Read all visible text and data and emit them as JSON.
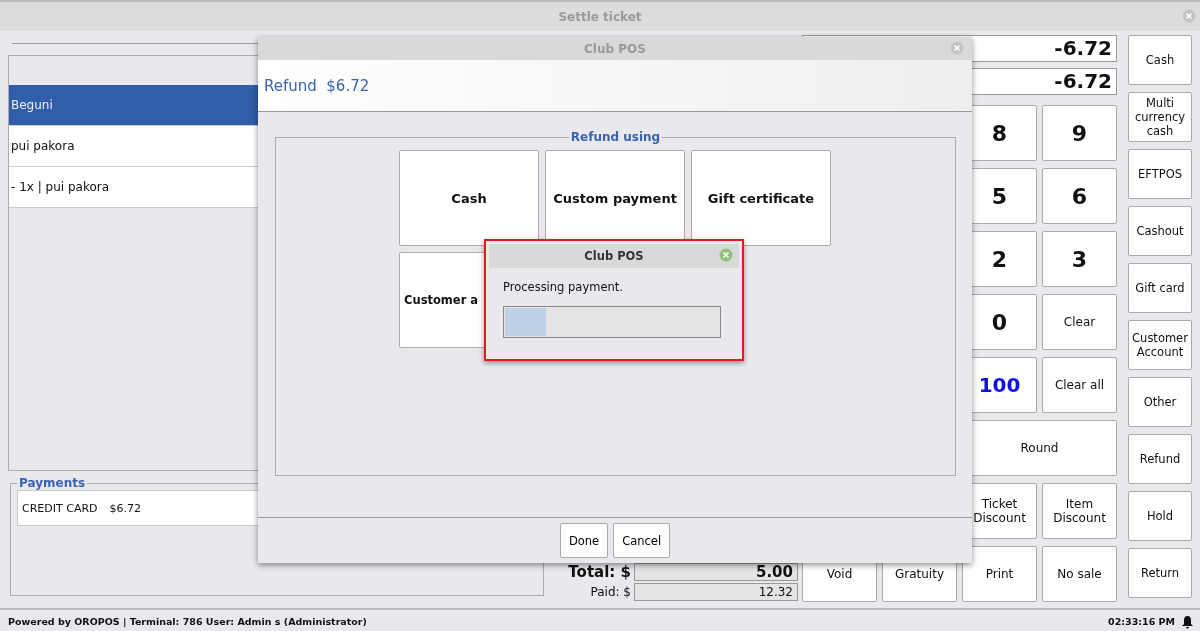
{
  "window": {
    "title": "Settle ticket"
  },
  "ticket_items": [
    {
      "label": "Beguni",
      "selected": true
    },
    {
      "label": "pui pakora",
      "selected": false
    },
    {
      "label": "- 1x | pui pakora",
      "selected": false
    }
  ],
  "payments": {
    "legend": "Payments",
    "rows": [
      {
        "type": "CREDIT CARD",
        "amount": "$6.72"
      }
    ]
  },
  "totals": [
    {
      "label": "Total: $",
      "value": "5.00"
    },
    {
      "label": "Paid: $",
      "value": "12.32"
    }
  ],
  "displays": [
    "-6.72",
    "-6.72"
  ],
  "keypad": [
    [
      {
        "label": "8",
        "kind": "digit"
      },
      {
        "label": "9",
        "kind": "digit"
      }
    ],
    [
      {
        "label": "5",
        "kind": "digit"
      },
      {
        "label": "6",
        "kind": "digit"
      }
    ],
    [
      {
        "label": "2",
        "kind": "digit"
      },
      {
        "label": "3",
        "kind": "digit"
      }
    ],
    [
      {
        "label": "0",
        "kind": "digit"
      },
      {
        "label": "Clear",
        "kind": "action"
      }
    ],
    [
      {
        "label": "100",
        "kind": "amount"
      },
      {
        "label": "Clear all",
        "kind": "action"
      }
    ],
    [
      {
        "label": "Round",
        "kind": "action"
      }
    ],
    [
      {
        "label": "Ticket Discount",
        "kind": "action"
      },
      {
        "label": "Item Discount",
        "kind": "action"
      }
    ],
    [
      {
        "label": "Void",
        "kind": "action"
      },
      {
        "label": "Gratuity",
        "kind": "action"
      },
      {
        "label": "Print",
        "kind": "action"
      },
      {
        "label": "No sale",
        "kind": "action"
      }
    ]
  ],
  "payment_buttons": [
    "Cash",
    "Multi currency cash",
    "EFTPOS",
    "Cashout",
    "Gift card",
    "Customer Account",
    "Other",
    "Refund",
    "Hold",
    "Return"
  ],
  "status_bar": {
    "text": "Powered by OROPOS | Terminal: 786  User: Admin s (Administrator)",
    "time": "02:33:16 PM"
  },
  "refund_dialog": {
    "title": "Club POS",
    "heading": "Refund  $6.72",
    "legend": "Refund using",
    "methods": [
      "Cash",
      "Custom payment",
      "Gift certificate",
      "Customer a"
    ],
    "buttons": [
      "Done",
      "Cancel"
    ]
  },
  "progress_dialog": {
    "title": "Club POS",
    "message": "Processing payment.",
    "level": 0.19
  }
}
